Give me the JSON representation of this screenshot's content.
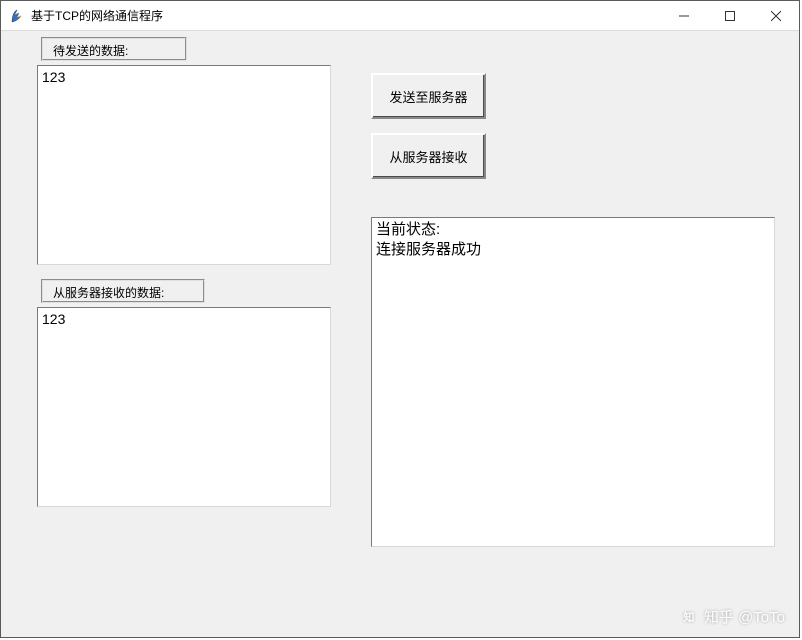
{
  "window": {
    "title": "基于TCP的网络通信程序"
  },
  "labels": {
    "send_frame": "待发送的数据:",
    "recv_frame": "从服务器接收的数据:"
  },
  "buttons": {
    "send": "发送至服务器",
    "recv": "从服务器接收"
  },
  "text": {
    "send_box": "123",
    "recv_box": "123",
    "status_box": "当前状态:\n连接服务器成功"
  },
  "watermark": {
    "logo_text": "知",
    "text": "知乎 @ToTo"
  }
}
